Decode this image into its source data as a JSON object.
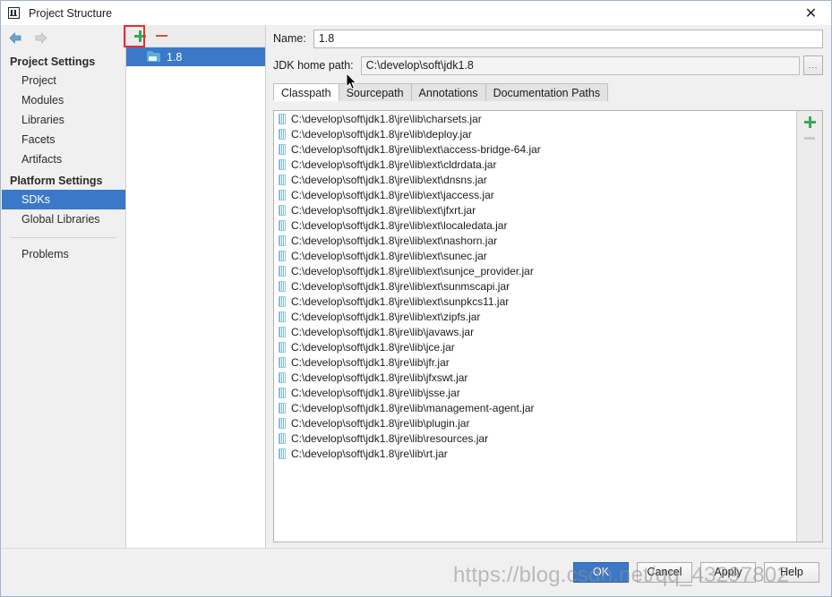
{
  "window": {
    "title": "Project Structure",
    "logo_icon": "intellij-idea-icon",
    "close_icon": "close-icon"
  },
  "nav": {
    "back_icon": "arrow-left-icon",
    "forward_icon": "arrow-right-icon"
  },
  "sidebar": {
    "groups": [
      {
        "label": "Project Settings",
        "items": [
          {
            "label": "Project",
            "selected": false
          },
          {
            "label": "Modules",
            "selected": false
          },
          {
            "label": "Libraries",
            "selected": false
          },
          {
            "label": "Facets",
            "selected": false
          },
          {
            "label": "Artifacts",
            "selected": false
          }
        ]
      },
      {
        "label": "Platform Settings",
        "items": [
          {
            "label": "SDKs",
            "selected": true
          },
          {
            "label": "Global Libraries",
            "selected": false
          }
        ]
      }
    ],
    "footer_items": [
      {
        "label": "Problems",
        "selected": false
      }
    ]
  },
  "sdk_pane": {
    "toolbar": {
      "add_icon": "plus-icon",
      "add_label": "+",
      "remove_icon": "minus-icon",
      "remove_label": "–"
    },
    "items": [
      {
        "label": "1.8",
        "icon": "folder-icon",
        "selected": true
      }
    ]
  },
  "detail": {
    "name_field": {
      "label": "Name:",
      "value": "1.8",
      "placeholder": ""
    },
    "jdk_home_field": {
      "label": "JDK home path:",
      "value": "C:\\develop\\soft\\jdk1.8",
      "placeholder": "",
      "browse_label": "...",
      "browse_icon": "ellipsis-icon"
    },
    "tabs": [
      {
        "label": "Classpath",
        "active": true
      },
      {
        "label": "Sourcepath",
        "active": false
      },
      {
        "label": "Annotations",
        "active": false
      },
      {
        "label": "Documentation Paths",
        "active": false
      }
    ],
    "classpath": {
      "side_add_icon": "plus-icon",
      "side_remove_icon": "minus-icon",
      "entries": [
        "C:\\develop\\soft\\jdk1.8\\jre\\lib\\charsets.jar",
        "C:\\develop\\soft\\jdk1.8\\jre\\lib\\deploy.jar",
        "C:\\develop\\soft\\jdk1.8\\jre\\lib\\ext\\access-bridge-64.jar",
        "C:\\develop\\soft\\jdk1.8\\jre\\lib\\ext\\cldrdata.jar",
        "C:\\develop\\soft\\jdk1.8\\jre\\lib\\ext\\dnsns.jar",
        "C:\\develop\\soft\\jdk1.8\\jre\\lib\\ext\\jaccess.jar",
        "C:\\develop\\soft\\jdk1.8\\jre\\lib\\ext\\jfxrt.jar",
        "C:\\develop\\soft\\jdk1.8\\jre\\lib\\ext\\localedata.jar",
        "C:\\develop\\soft\\jdk1.8\\jre\\lib\\ext\\nashorn.jar",
        "C:\\develop\\soft\\jdk1.8\\jre\\lib\\ext\\sunec.jar",
        "C:\\develop\\soft\\jdk1.8\\jre\\lib\\ext\\sunjce_provider.jar",
        "C:\\develop\\soft\\jdk1.8\\jre\\lib\\ext\\sunmscapi.jar",
        "C:\\develop\\soft\\jdk1.8\\jre\\lib\\ext\\sunpkcs11.jar",
        "C:\\develop\\soft\\jdk1.8\\jre\\lib\\ext\\zipfs.jar",
        "C:\\develop\\soft\\jdk1.8\\jre\\lib\\javaws.jar",
        "C:\\develop\\soft\\jdk1.8\\jre\\lib\\jce.jar",
        "C:\\develop\\soft\\jdk1.8\\jre\\lib\\jfr.jar",
        "C:\\develop\\soft\\jdk1.8\\jre\\lib\\jfxswt.jar",
        "C:\\develop\\soft\\jdk1.8\\jre\\lib\\jsse.jar",
        "C:\\develop\\soft\\jdk1.8\\jre\\lib\\management-agent.jar",
        "C:\\develop\\soft\\jdk1.8\\jre\\lib\\plugin.jar",
        "C:\\develop\\soft\\jdk1.8\\jre\\lib\\resources.jar",
        "C:\\develop\\soft\\jdk1.8\\jre\\lib\\rt.jar"
      ]
    }
  },
  "buttons": [
    {
      "label": "OK",
      "primary": true
    },
    {
      "label": "Cancel",
      "primary": false
    },
    {
      "label": "Apply",
      "primary": false
    },
    {
      "label": "Help",
      "primary": false
    }
  ],
  "overlay": {
    "watermark": "https://blog.csdn.net/qq_43297802",
    "highlight_color": "#ef2b2b"
  },
  "colors": {
    "accent": "#3c78c8",
    "add_green": "#3aa757",
    "remove_red": "#c75450",
    "highlight_red": "#ef2b2b"
  }
}
